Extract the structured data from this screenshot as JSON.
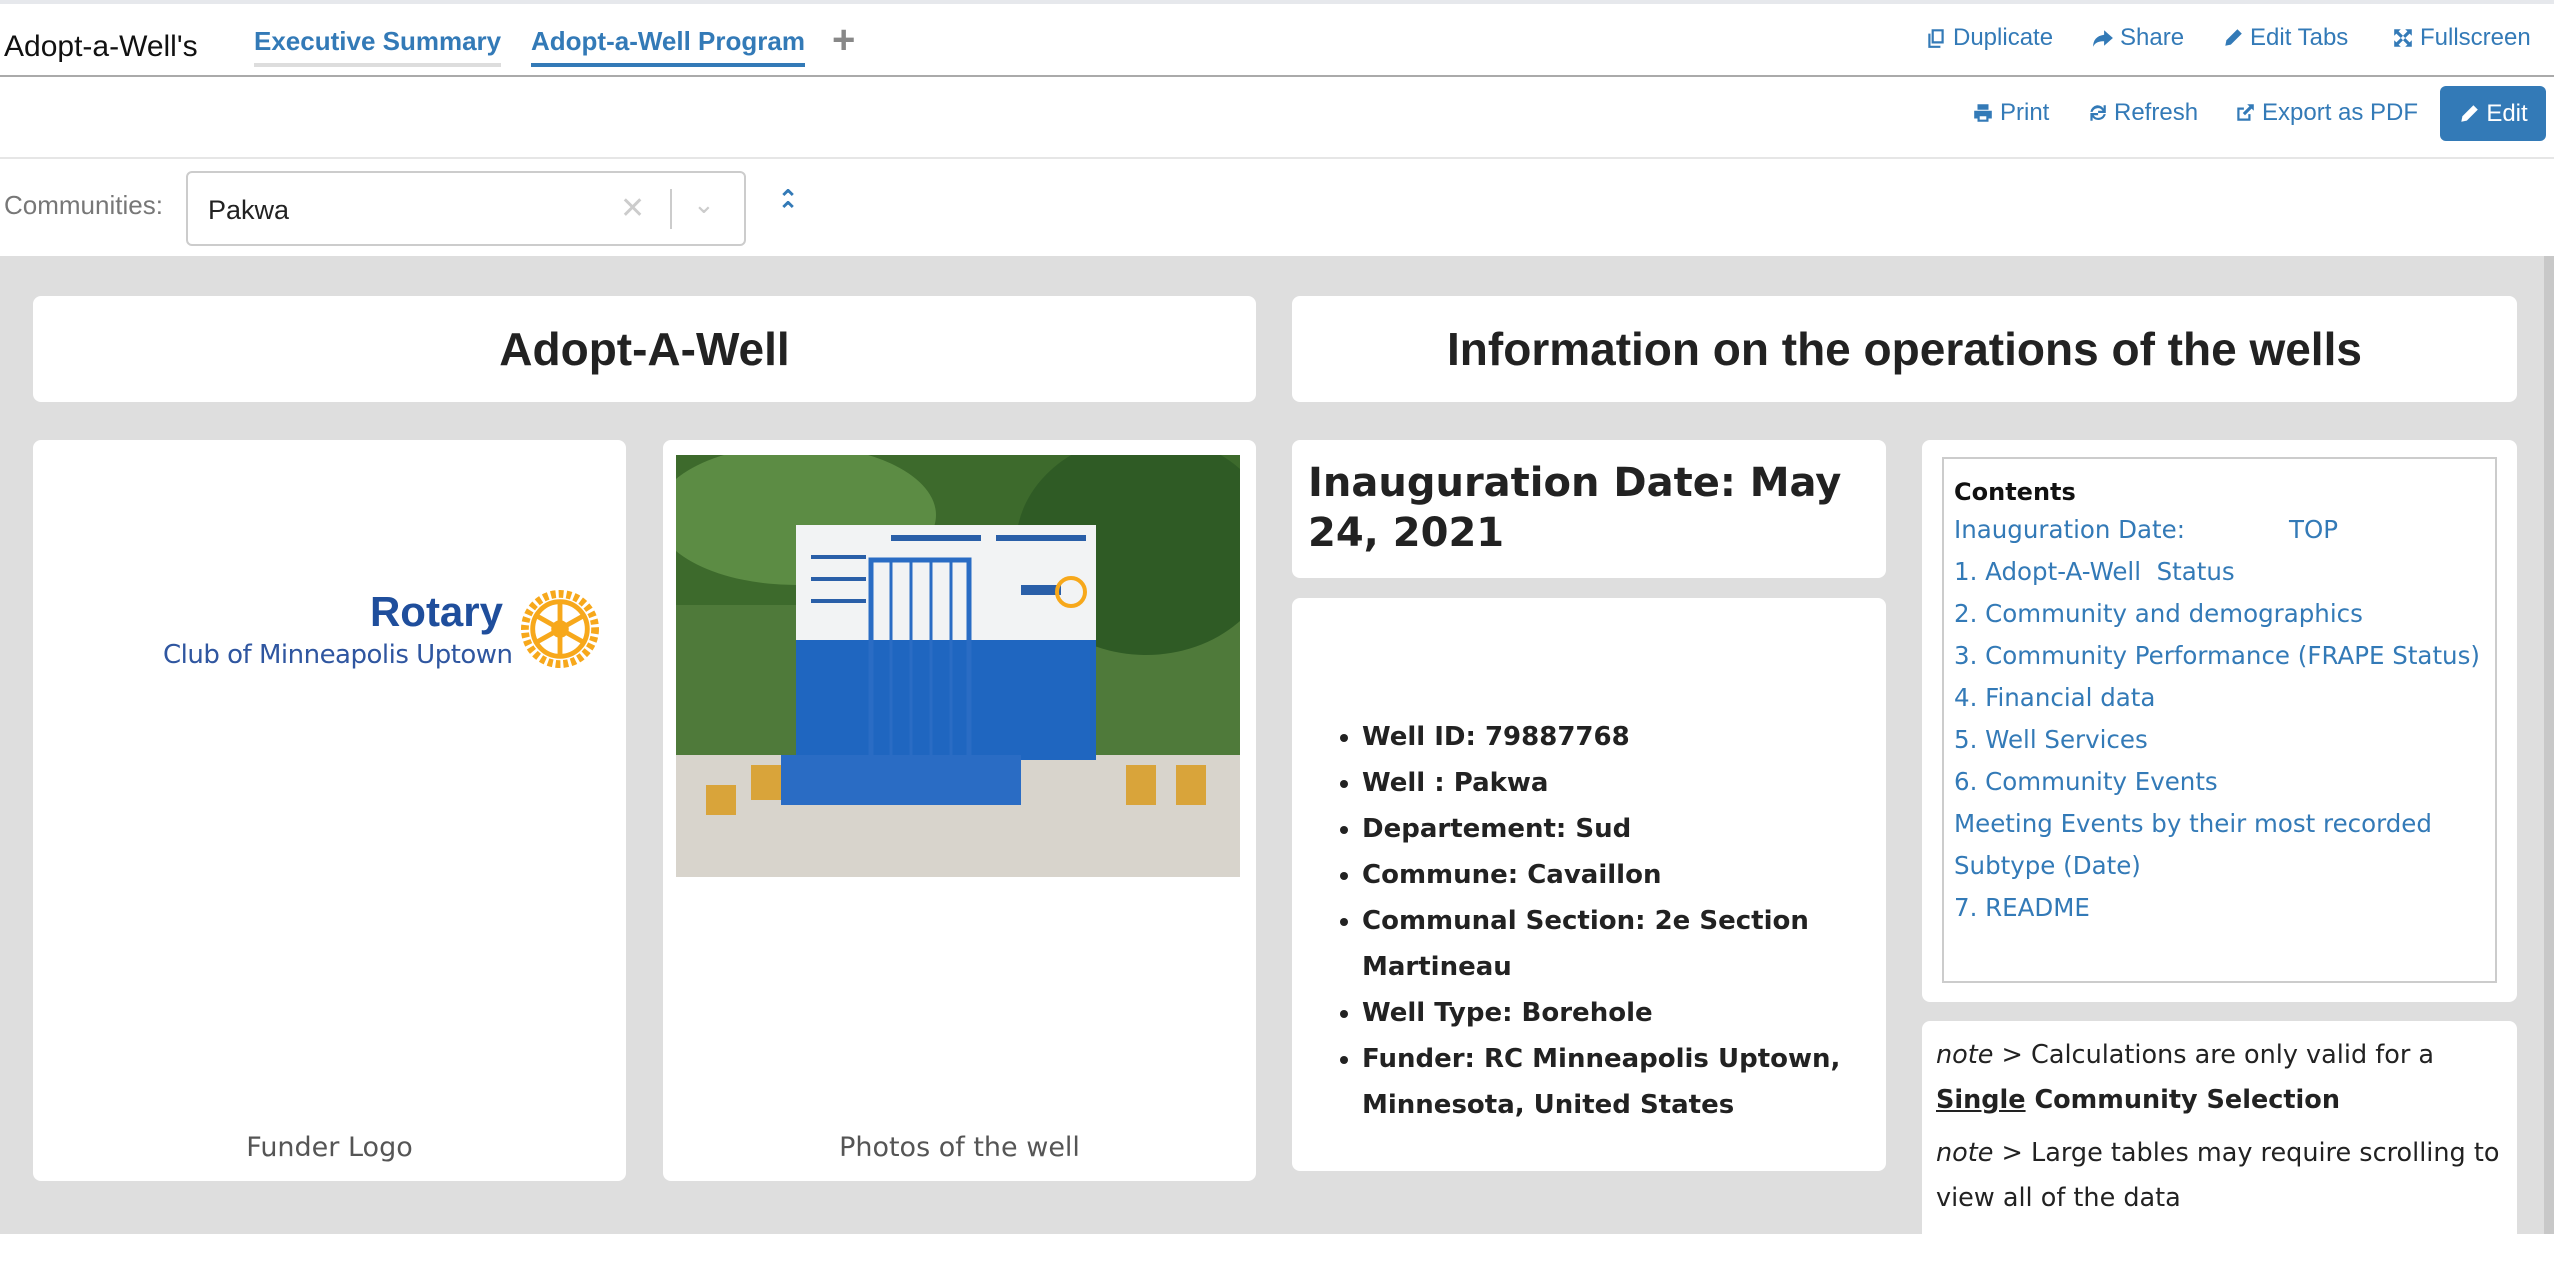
{
  "header": {
    "dashboard_title": "Adopt-a-Well's",
    "tabs": [
      {
        "label": "Executive Summary",
        "active": false
      },
      {
        "label": "Adopt-a-Well Program",
        "active": true
      }
    ],
    "add_tab_label": "+",
    "actions": {
      "duplicate": "Duplicate",
      "share": "Share",
      "edit_tabs": "Edit Tabs",
      "fullscreen": "Fullscreen"
    }
  },
  "toolbar": {
    "print": "Print",
    "refresh": "Refresh",
    "export_pdf": "Export as PDF",
    "edit": "Edit"
  },
  "filter": {
    "label": "Communities:",
    "value": "Pakwa",
    "clear": "✕",
    "chevron": "⌄",
    "collapse": "⌃"
  },
  "cards": {
    "left_title": "Adopt-A-Well",
    "right_title": "Information on the operations of the wells",
    "funder_logo": {
      "brand": "Rotary",
      "subtitle": "Club of Minneapolis Uptown",
      "caption": "Funder Logo"
    },
    "photo_caption": "Photos of the well",
    "inauguration": "Inauguration Date: May 24, 2021",
    "well_info": [
      "Well ID: 79887768",
      "Well : Pakwa",
      "Departement: Sud",
      "Commune: Cavaillon",
      "Communal Section: 2e Section Martineau",
      "Well Type: Borehole",
      "Funder: RC Minneapolis Uptown, Minnesota, United States"
    ],
    "contents": {
      "heading": "Contents",
      "first_link": "Inauguration Date:",
      "top_link": "TOP",
      "links": [
        "1. Adopt-A-Well  Status",
        "2. Community and demographics",
        "3. Community Performance (FRAPE Status)",
        "4. Financial data",
        "5. Well Services",
        "6. Community Events",
        "Meeting Events by their most recorded Subtype (Date)",
        "7. README"
      ]
    },
    "notes": {
      "prefix": "note >",
      "note1_text": " Calculations are only valid for a ",
      "note1_emph": "Single",
      "note1_tail": " Community Selection",
      "note2_text": " Large tables may require scrolling to view all of the data"
    }
  },
  "colors": {
    "accent": "#337ab7",
    "background": "#dedede",
    "rotary_blue": "#1f4e9c",
    "rotary_gold": "#f7a81b"
  }
}
